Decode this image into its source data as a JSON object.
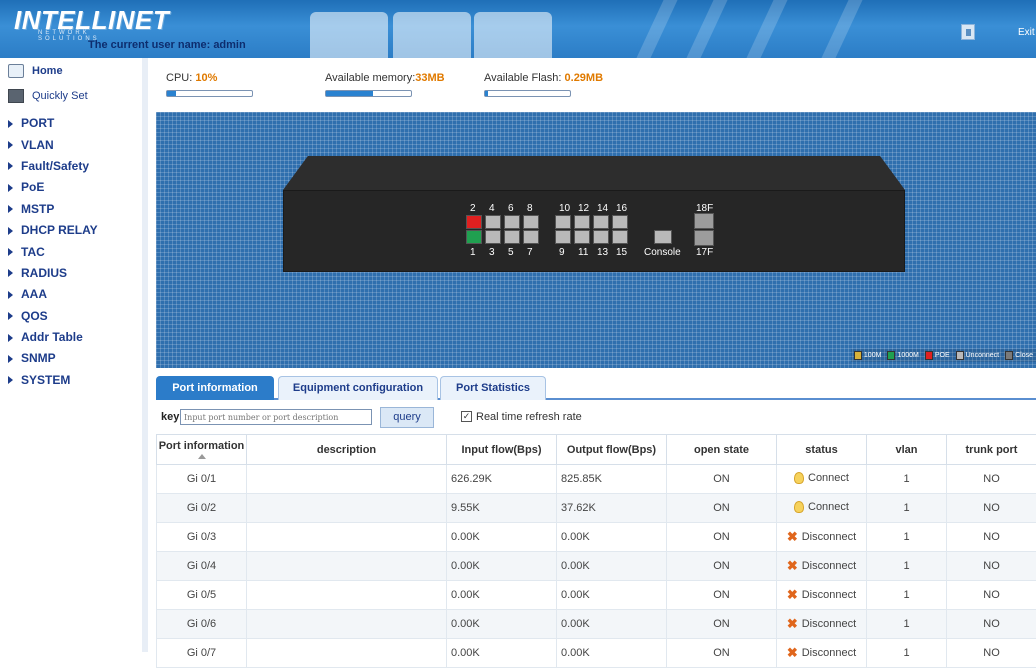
{
  "header": {
    "logo": "INTELLINET",
    "logo_sub": "NETWORK SOLUTIONS",
    "username_label": "The current user name: admin",
    "exit_label": "Exit"
  },
  "sidebar": {
    "home": "Home",
    "quick": "Quickly Set",
    "items": [
      "PORT",
      "VLAN",
      "Fault/Safety",
      "PoE",
      "MSTP",
      "DHCP RELAY",
      "TAC",
      "RADIUS",
      "AAA",
      "QOS",
      "Addr Table",
      "SNMP",
      "SYSTEM"
    ]
  },
  "stats": {
    "cpu_label": "CPU: ",
    "cpu_value": "10%",
    "cpu_level": 0.1,
    "mem_label": "Available memory:",
    "mem_value": "33MB",
    "mem_level": 0.55,
    "flash_label": "Available Flash: ",
    "flash_value": "0.29MB",
    "flash_level": 0.03
  },
  "device": {
    "top_numbers": [
      "2",
      "4",
      "6",
      "8",
      "10",
      "12",
      "14",
      "16"
    ],
    "bottom_numbers": [
      "1",
      "3",
      "5",
      "7",
      "9",
      "11",
      "13",
      "15"
    ],
    "console_label": "Console",
    "sfp_top": "18F",
    "sfp_bottom": "17F",
    "legend": [
      "100M",
      "1000M",
      "POE",
      "Unconnect",
      "Close"
    ],
    "colors": {
      "red": "#e02020",
      "green": "#20a050",
      "grey": "#b9b9b9"
    }
  },
  "tabs": [
    "Port information",
    "Equipment configuration",
    "Port Statistics"
  ],
  "query": {
    "label": "key",
    "placeholder": "Input port number or port description",
    "button": "query",
    "refresh_label": "Real time refresh rate",
    "refresh_checked": true
  },
  "table": {
    "headers": [
      "Port information",
      "description",
      "Input flow(Bps)",
      "Output flow(Bps)",
      "open state",
      "status",
      "vlan",
      "trunk port"
    ],
    "rows": [
      [
        "Gi 0/1",
        "",
        "626.29K",
        "825.85K",
        "ON",
        "Connect",
        "1",
        "NO"
      ],
      [
        "Gi 0/2",
        "",
        "9.55K",
        "37.62K",
        "ON",
        "Connect",
        "1",
        "NO"
      ],
      [
        "Gi 0/3",
        "",
        "0.00K",
        "0.00K",
        "ON",
        "Disconnect",
        "1",
        "NO"
      ],
      [
        "Gi 0/4",
        "",
        "0.00K",
        "0.00K",
        "ON",
        "Disconnect",
        "1",
        "NO"
      ],
      [
        "Gi 0/5",
        "",
        "0.00K",
        "0.00K",
        "ON",
        "Disconnect",
        "1",
        "NO"
      ],
      [
        "Gi 0/6",
        "",
        "0.00K",
        "0.00K",
        "ON",
        "Disconnect",
        "1",
        "NO"
      ],
      [
        "Gi 0/7",
        "",
        "0.00K",
        "0.00K",
        "ON",
        "Disconnect",
        "1",
        "NO"
      ]
    ]
  }
}
